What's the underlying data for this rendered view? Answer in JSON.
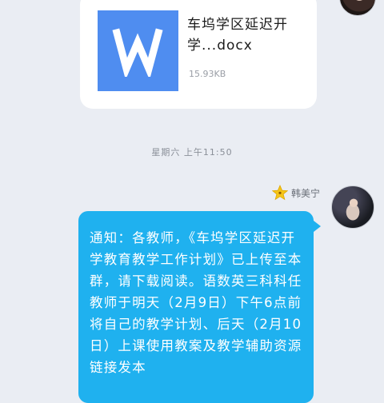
{
  "file_message": {
    "file_name": "车坞学区延迟开学...docx",
    "file_size": "15.93KB",
    "file_type_icon": "word-doc-icon",
    "icon_color": "#4f8df0"
  },
  "timestamp": "星期六 上午11:50",
  "sender": {
    "name": "韩美宁",
    "badge_icon": "star-badge-icon",
    "badge_color": "#f5c518"
  },
  "message": {
    "text": "通知：各教师，《车坞学区延迟开学教育教学工作计划》已上传至本群，请下载阅读。语数英三科科任教师于明天（2月9日）下午6点前将自己的教学计划、后天（2月10日）上课使用教案及教学辅助资源链接发本",
    "bubble_color": "#1fb1ef"
  },
  "colors": {
    "background": "#eaedf3",
    "card": "#ffffff"
  }
}
